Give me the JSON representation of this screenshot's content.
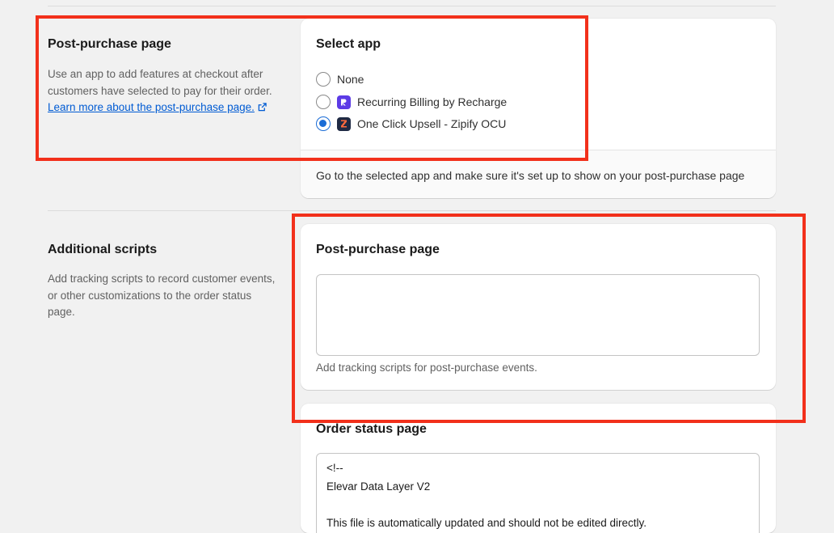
{
  "post_purchase_section": {
    "title": "Post-purchase page",
    "description": "Use an app to add features at checkout after customers have selected to pay for their order. ",
    "learn_more_link": "Learn more about the post-purchase page."
  },
  "select_app_card": {
    "title": "Select app",
    "options": [
      {
        "label": "None",
        "checked": false,
        "icon": null
      },
      {
        "label": "Recurring Billing by Recharge",
        "checked": false,
        "icon": "recharge-app-icon",
        "icon_color": "#5c3be6"
      },
      {
        "label": "One Click Upsell - Zipify OCU",
        "checked": true,
        "icon": "zipify-app-icon",
        "icon_color": "#1f2a44"
      }
    ],
    "footer_text": "Go to the selected app and make sure it's set up to show on your post-purchase page"
  },
  "additional_scripts_section": {
    "title": "Additional scripts",
    "description": "Add tracking scripts to record customer events, or other customizations to the order status page."
  },
  "post_purchase_scripts_card": {
    "title": "Post-purchase page",
    "textarea_value": "",
    "help_text": "Add tracking scripts for post-purchase events."
  },
  "order_status_card": {
    "title": "Order status page",
    "code_lines": [
      "<!--",
      "Elevar Data Layer V2",
      "",
      "This file is automatically updated and should not be edited directly."
    ]
  },
  "colors": {
    "accent": "#1a6cd6",
    "link": "#005bd3",
    "highlight_box": "#f2301b",
    "background": "#f1f1f1"
  }
}
